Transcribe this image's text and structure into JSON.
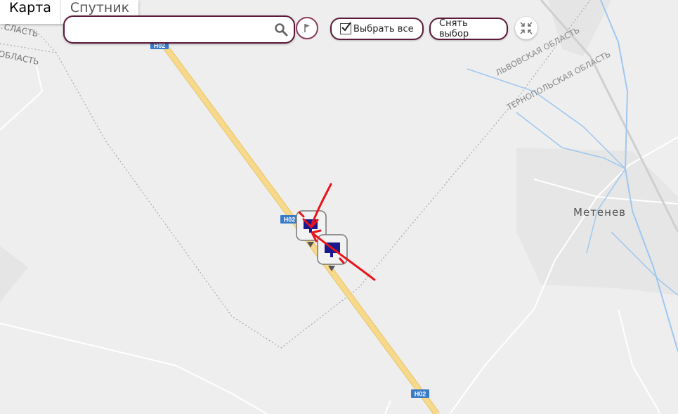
{
  "map_type_tabs": [
    {
      "label": "Карта",
      "active": true
    },
    {
      "label": "Спутник",
      "active": false
    }
  ],
  "search": {
    "value": "",
    "placeholder": ""
  },
  "toolbar": {
    "select_all_label": "Выбрать все",
    "select_all_checked": true,
    "deselect_label": "Снять выбор"
  },
  "map_labels": {
    "region_partial_top": "СЛАСТЬ",
    "region_partial_left": "ОБЛАСТЬ",
    "lviv_region": "ЛЬВОВСКАЯ ОБЛАСТЬ",
    "ternopil_region": "ТЕРНОПОЛЬСКАЯ ОБЛАСТЬ",
    "town": "Метенев",
    "road_shield": "H02"
  },
  "colors": {
    "button_border": "#5c1a3a",
    "road_fill": "#f7d98b",
    "road_edge": "#e9c46a",
    "water": "#9fc7f0",
    "road_shield_bg": "#3a7bc8",
    "annotation": "#e8141a",
    "marker_fill": "#1a1a8c"
  },
  "icons": {
    "search": "search-icon",
    "flag": "flag-icon",
    "collapse": "collapse-icon",
    "marker": "vehicle-marker-icon"
  }
}
